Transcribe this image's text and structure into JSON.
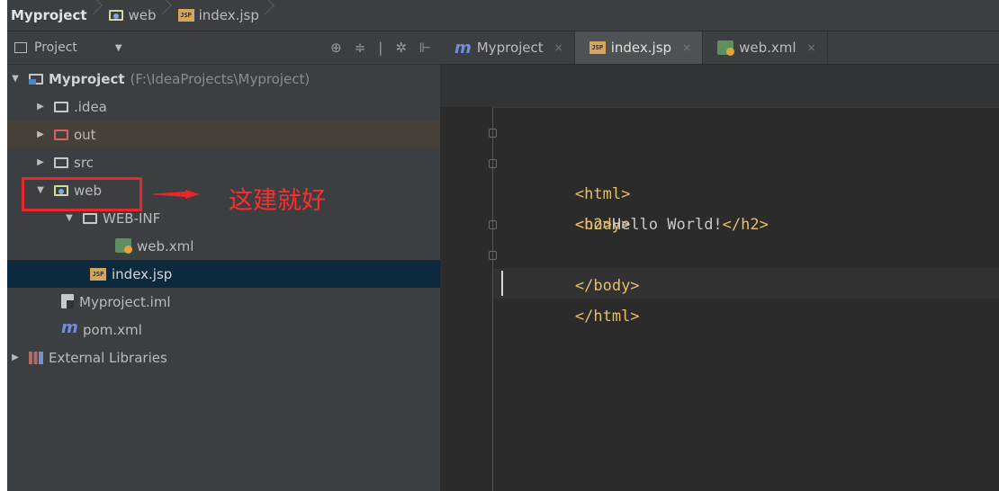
{
  "breadcrumb": {
    "project": "Myproject",
    "folder": "web",
    "file": "index.jsp"
  },
  "panel": {
    "title": "Project",
    "tools": [
      "⊕",
      "≑",
      "|",
      "✲",
      "⊩"
    ]
  },
  "tree": {
    "root_name": "Myproject",
    "root_path": "(F:\\IdeaProjects\\Myproject)",
    "idea": ".idea",
    "out": "out",
    "src": "src",
    "web": "web",
    "webinf": "WEB-INF",
    "webxml": "web.xml",
    "indexjsp": "index.jsp",
    "iml": "Myproject.iml",
    "pom": "pom.xml",
    "libs": "External Libraries"
  },
  "annotation": {
    "label": "这建就好"
  },
  "tabs": [
    {
      "label": "Myproject",
      "icon": "maven-icon",
      "close": "×"
    },
    {
      "label": "index.jsp",
      "icon": "jsp-file-icon",
      "close": "×"
    },
    {
      "label": "web.xml",
      "icon": "xml-file-icon",
      "close": "×"
    }
  ],
  "code": {
    "line1": "<html>",
    "line2": "<body>",
    "line3_open": "<h2>",
    "line3_text": "Hello World!",
    "line3_close": "</h2>",
    "line4": "</body>",
    "line5": "</html>"
  },
  "colors": {
    "tag": "#e8bf6a",
    "text": "#c9c9c9",
    "highlight": "#e8262c",
    "selection": "#0d293e"
  }
}
